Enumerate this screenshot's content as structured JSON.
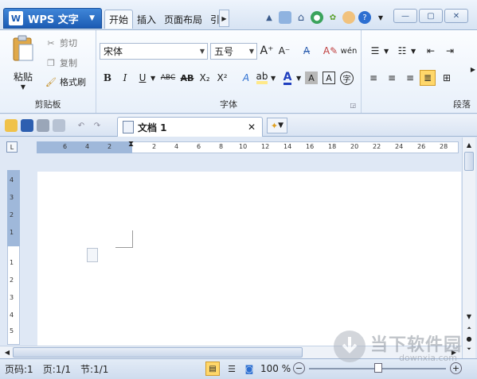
{
  "app": {
    "name": "WPS 文字"
  },
  "tabs": [
    "开始",
    "插入",
    "页面布局",
    "引"
  ],
  "ribbon": {
    "clipboard": {
      "paste": "粘贴",
      "cut": "剪切",
      "copy": "复制",
      "format_painter": "格式刷",
      "group_label": "剪贴板"
    },
    "font": {
      "font_name": "宋体",
      "font_size": "五号",
      "group_label": "字体"
    },
    "paragraph": {
      "group_label": "段落"
    }
  },
  "doc_tabs": [
    {
      "title": "文档 1"
    }
  ],
  "ruler": {
    "ticks": [
      "6",
      "4",
      "2",
      "2",
      "4",
      "6",
      "8",
      "10",
      "12",
      "14",
      "16",
      "18",
      "20",
      "22",
      "24",
      "26",
      "28"
    ]
  },
  "vruler": {
    "ticks": [
      "4",
      "3",
      "2",
      "1",
      "1",
      "2",
      "3",
      "4",
      "5"
    ]
  },
  "status": {
    "page_code": "页码:1",
    "page": "页:1/1",
    "section": "节:1/1",
    "zoom": "100 %"
  },
  "watermark": {
    "cn": "当下软件园",
    "url": "downxia.com"
  },
  "colors": {
    "accent": "#1c5cb4",
    "highlight": "#ffe98a",
    "font_color": "#1f3fbf"
  }
}
